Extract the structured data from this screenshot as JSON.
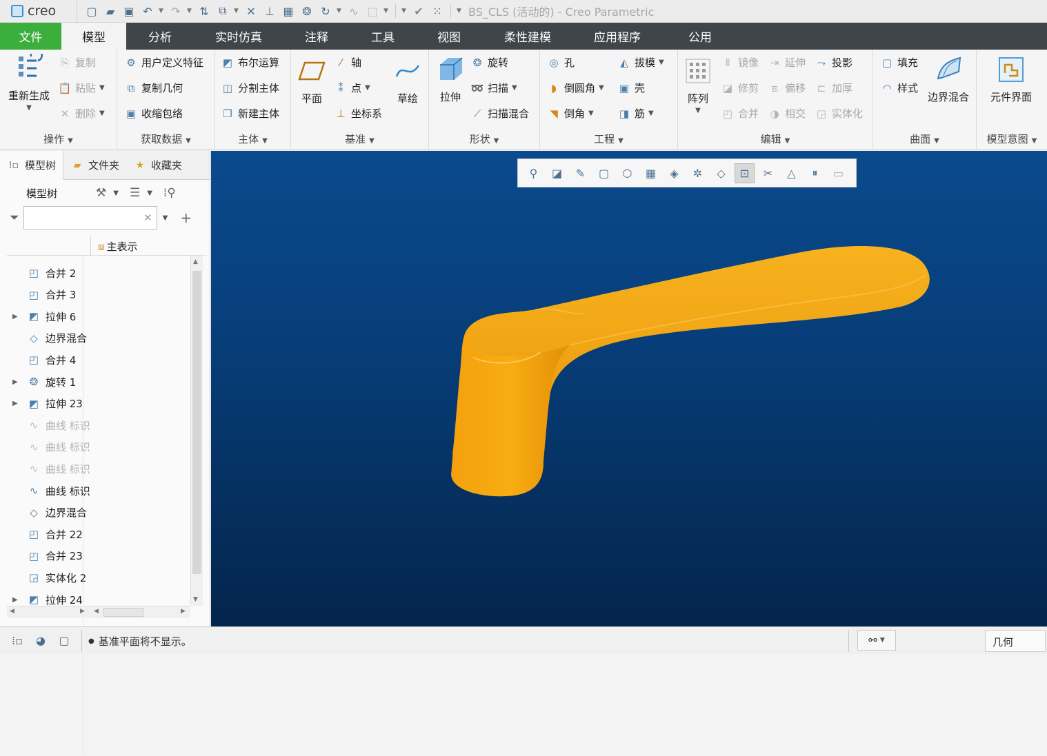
{
  "app": {
    "logo": "creo",
    "window_title": "BS_CLS (活动的) - Creo Parametric"
  },
  "quick_access": [
    "new-icon",
    "open-icon",
    "save-icon",
    "undo-icon",
    "redo-icon",
    "regenerate-icon",
    "window-icon",
    "close-window-icon",
    "csys-icon",
    "datum-icon",
    "revolve-icon",
    "sweep-icon",
    "curve-icon",
    "sketch-icon",
    "check-icon",
    "grid-icon"
  ],
  "tabs": [
    "文件",
    "模型",
    "分析",
    "实时仿真",
    "注释",
    "工具",
    "视图",
    "柔性建模",
    "应用程序",
    "公用"
  ],
  "ribbon": {
    "operations": {
      "regenerate": "重新生成",
      "copy": "复制",
      "paste": "粘贴",
      "delete": "删除",
      "label": "操作"
    },
    "get_data": {
      "udf": "用户定义特征",
      "copy_geom": "复制几何",
      "shrinkwrap": "收缩包络",
      "label": "获取数据"
    },
    "body": {
      "boolean": "布尔运算",
      "split": "分割主体",
      "new_body": "新建主体",
      "label": "主体"
    },
    "datum": {
      "plane": "平面",
      "axis": "轴",
      "point": "点",
      "csys": "坐标系",
      "sketch": "草绘",
      "label": "基准"
    },
    "shapes": {
      "extrude": "拉伸",
      "revolve": "旋转",
      "sweep": "扫描",
      "swept_blend": "扫描混合",
      "label": "形状"
    },
    "engineering": {
      "hole": "孔",
      "round": "倒圆角",
      "chamfer": "倒角",
      "draft": "拔模",
      "shell": "壳",
      "rib": "筋",
      "label": "工程"
    },
    "editing": {
      "pattern": "阵列",
      "mirror": "镜像",
      "extend": "延伸",
      "project": "投影",
      "trim": "修剪",
      "offset": "偏移",
      "thicken": "加厚",
      "merge": "合并",
      "intersect": "相交",
      "solidify": "实体化",
      "label": "编辑"
    },
    "surfaces": {
      "fill": "填充",
      "style": "样式",
      "boundary_blend": "边界混合",
      "label": "曲面"
    },
    "model_intent": {
      "component_interface": "元件界面",
      "label": "模型意图"
    }
  },
  "left_panel": {
    "tabs": [
      "模型树",
      "文件夹",
      "收藏夹"
    ],
    "tree_title": "模型树",
    "filter_value": "",
    "column_header": "主表示",
    "rows": [
      {
        "label": "合并 2",
        "expandable": false,
        "dim": false,
        "icon": "merge-icon"
      },
      {
        "label": "合并 3",
        "expandable": false,
        "dim": false,
        "icon": "merge-icon"
      },
      {
        "label": "拉伸 6",
        "expandable": true,
        "dim": false,
        "icon": "extrude-icon"
      },
      {
        "label": "边界混合",
        "expandable": false,
        "dim": false,
        "icon": "boundary-blend-icon"
      },
      {
        "label": "合并 4",
        "expandable": false,
        "dim": false,
        "icon": "merge-icon"
      },
      {
        "label": "旋转 1",
        "expandable": true,
        "dim": false,
        "icon": "revolve-icon"
      },
      {
        "label": "拉伸 23",
        "expandable": true,
        "dim": false,
        "icon": "extrude-icon"
      },
      {
        "label": "曲线 标识",
        "expandable": false,
        "dim": true,
        "icon": "curve-icon"
      },
      {
        "label": "曲线 标识",
        "expandable": false,
        "dim": true,
        "icon": "curve-icon"
      },
      {
        "label": "曲线 标识",
        "expandable": false,
        "dim": true,
        "icon": "curve-icon"
      },
      {
        "label": "曲线 标识",
        "expandable": false,
        "dim": false,
        "icon": "curve-icon"
      },
      {
        "label": "边界混合",
        "expandable": false,
        "dim": false,
        "icon": "boundary-blend-icon"
      },
      {
        "label": "合并 22",
        "expandable": false,
        "dim": false,
        "icon": "merge-icon"
      },
      {
        "label": "合并 23",
        "expandable": false,
        "dim": false,
        "icon": "merge-icon"
      },
      {
        "label": "实体化 2",
        "expandable": false,
        "dim": false,
        "icon": "solidify-icon"
      },
      {
        "label": "拉伸 24",
        "expandable": true,
        "dim": false,
        "icon": "extrude-icon"
      }
    ]
  },
  "view_toolbar": [
    "zoom-in-icon",
    "zoom-fit-icon",
    "repaint-icon",
    "perspective-icon",
    "saved-views-icon",
    "display-style-icon",
    "view-manager-icon",
    "datum-display-icon",
    "annotation-display-icon",
    "spin-center-icon",
    "section-icon",
    "appearance-icon",
    "pause-icon",
    "dynamic-icon"
  ],
  "status": {
    "message": "基准平面将不显示。",
    "filter": "几何"
  },
  "colors": {
    "accent_green": "#3cae3c",
    "tabbar": "#3f4548",
    "model": "#f29f05"
  }
}
